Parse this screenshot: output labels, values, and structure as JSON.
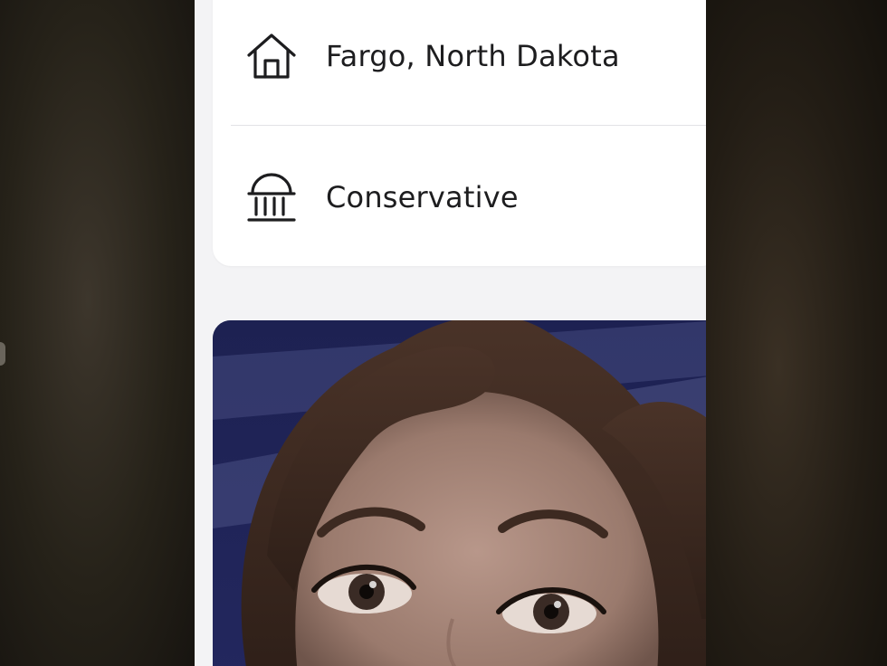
{
  "profile": {
    "details": [
      {
        "icon": "house-icon",
        "label": "Fargo, North Dakota"
      },
      {
        "icon": "dome-icon",
        "label": "Conservative"
      }
    ]
  },
  "colors": {
    "card_background": "#ffffff",
    "screen_background": "#f3f3f5",
    "text": "#1d1d1f",
    "photo_backdrop": "#1d2150"
  }
}
